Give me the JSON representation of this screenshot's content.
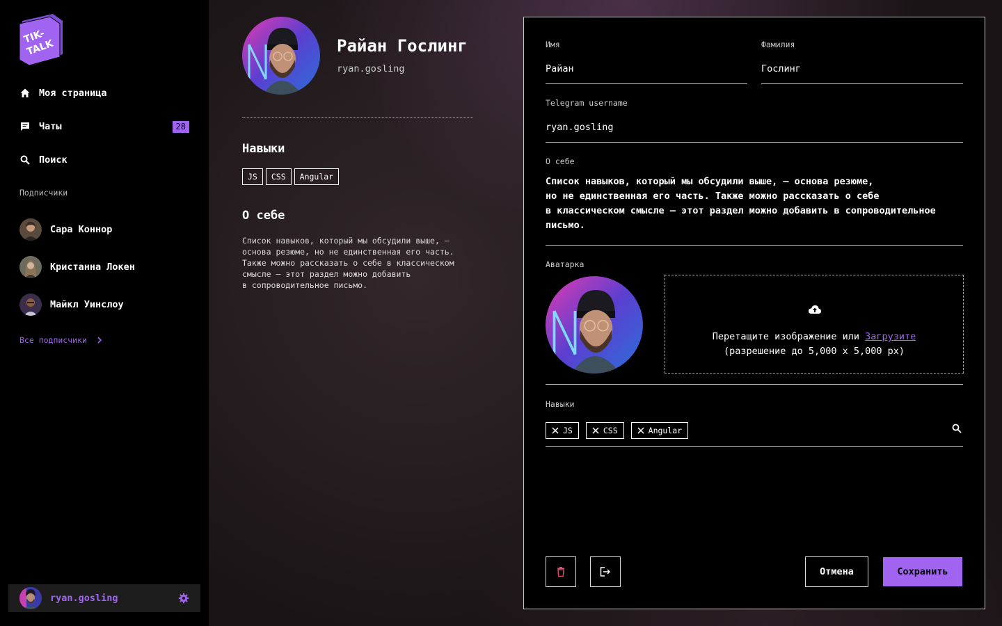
{
  "app": {
    "logo_text": "TIK-TALK",
    "accent": "#a064f0"
  },
  "sidebar": {
    "nav": [
      {
        "label": "Моя страница",
        "icon": "home-icon"
      },
      {
        "label": "Чаты",
        "icon": "chat-icon",
        "badge": "28"
      },
      {
        "label": "Поиск",
        "icon": "search-icon"
      }
    ],
    "subscribers_title": "Подписчики",
    "subscribers": [
      {
        "name": "Сара Коннор"
      },
      {
        "name": "Кристанна Локен"
      },
      {
        "name": "Майкл Уинслоу"
      }
    ],
    "all_subscribers": "Все подписчики",
    "me": {
      "username": "ryan.gosling"
    }
  },
  "profile": {
    "name": "Райан Гослинг",
    "username": "ryan.gosling",
    "skills_title": "Навыки",
    "skills": [
      "JS",
      "CSS",
      "Angular"
    ],
    "about_title": "О себе",
    "about_text": "Список навыков, который мы обсудили выше, —\nоснова резюме, но не единственная его часть.\nТакже можно рассказать о себе в классическом\nсмысле — этот раздел можно добавить\nв сопроводительное письмо."
  },
  "form": {
    "first_name": {
      "label": "Имя",
      "value": "Райан"
    },
    "last_name": {
      "label": "Фамилия",
      "value": "Гослинг"
    },
    "telegram": {
      "label": "Telegram username",
      "value": "ryan.gosling"
    },
    "about": {
      "label": "О себе",
      "value": "Список навыков, который мы обсудили выше, — основа резюме,\nно не единственная его часть. Также можно рассказать о себе\nв классическом смысле — этот раздел можно добавить в сопроводительное\nписьмо."
    },
    "avatar": {
      "label": "Аватарка",
      "drop_text": "Перетащите изображение или",
      "upload_link": "Загрузите",
      "hint": "(разрешение до 5,000 x 5,000 px)"
    },
    "skills": {
      "label": "Навыки",
      "chips": [
        "JS",
        "CSS",
        "Angular"
      ]
    },
    "cancel_label": "Отмена",
    "save_label": "Сохранить"
  }
}
